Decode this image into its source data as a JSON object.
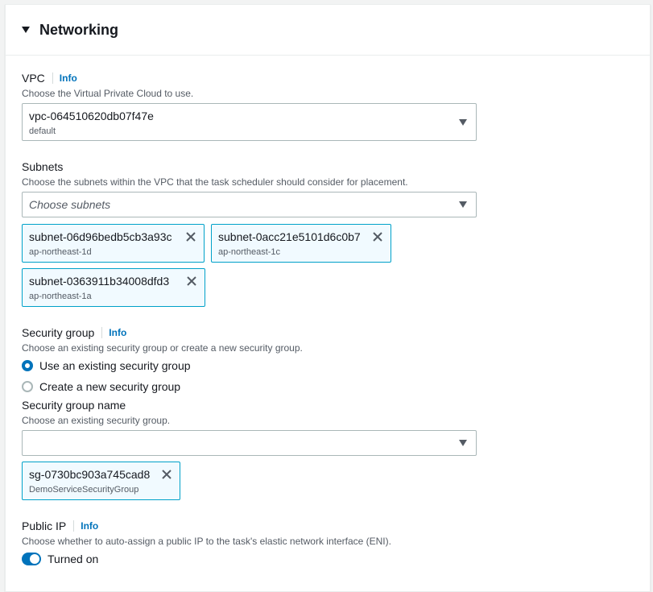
{
  "section": {
    "title": "Networking"
  },
  "vpc": {
    "label": "VPC",
    "info": "Info",
    "description": "Choose the Virtual Private Cloud to use.",
    "value": "vpc-064510620db07f47e",
    "value_sub": "default"
  },
  "subnets": {
    "label": "Subnets",
    "description": "Choose the subnets within the VPC that the task scheduler should consider for placement.",
    "placeholder": "Choose subnets",
    "tokens": [
      {
        "id": "subnet-06d96bedb5cb3a93c",
        "zone": "ap-northeast-1d"
      },
      {
        "id": "subnet-0acc21e5101d6c0b7",
        "zone": "ap-northeast-1c"
      },
      {
        "id": "subnet-0363911b34008dfd3",
        "zone": "ap-northeast-1a"
      }
    ]
  },
  "security_group": {
    "label": "Security group",
    "info": "Info",
    "description": "Choose an existing security group or create a new security group.",
    "options": [
      {
        "label": "Use an existing security group",
        "checked": true
      },
      {
        "label": "Create a new security group",
        "checked": false
      }
    ],
    "name_label": "Security group name",
    "name_description": "Choose an existing security group.",
    "name_value": "",
    "token": {
      "id": "sg-0730bc903a745cad8",
      "name": "DemoServiceSecurityGroup"
    }
  },
  "public_ip": {
    "label": "Public IP",
    "info": "Info",
    "description": "Choose whether to auto-assign a public IP to the task's elastic network interface (ENI).",
    "toggle_label": "Turned on",
    "enabled": true
  },
  "colors": {
    "accent": "#0073bb",
    "token_border": "#00a1c9",
    "token_bg": "#f1faff"
  }
}
